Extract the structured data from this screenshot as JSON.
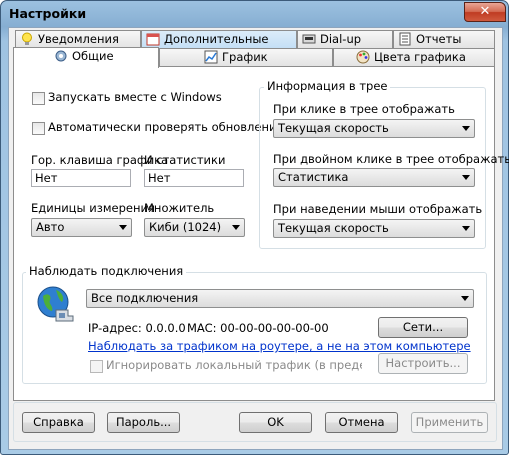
{
  "window": {
    "title": "Настройки",
    "close_label": "✕"
  },
  "tabs": {
    "row1": [
      {
        "label": "Уведомления",
        "icon": "bulb-icon"
      },
      {
        "label": "Дополнительные",
        "icon": "calendar-icon"
      },
      {
        "label": "Dial-up",
        "icon": "dialup-icon"
      },
      {
        "label": "Отчеты",
        "icon": "reports-icon"
      }
    ],
    "row2": [
      {
        "label": "Общие",
        "icon": "general-icon"
      },
      {
        "label": "График",
        "icon": "graph-icon"
      },
      {
        "label": "Цвета графика",
        "icon": "palette-icon"
      }
    ]
  },
  "general": {
    "autostart_label": "Запускать вместе с Windows",
    "autoupdate_label": "Автоматически проверять обновления",
    "hotkey_graph_label": "Гор. клавиша графика",
    "hotkey_stats_label": "И статистики",
    "hotkey_graph_value": "Нет",
    "hotkey_stats_value": "Нет",
    "units_label": "Единицы измерения",
    "units_value": "Авто",
    "multiplier_label": "Множитель",
    "multiplier_value": "Киби (1024)"
  },
  "tray": {
    "group_title": "Информация в трее",
    "click_label": "При клике в трее отображать",
    "click_value": "Текущая скорость",
    "dblclick_label": "При двойном клике в трее отображать",
    "dblclick_value": "Статистика",
    "hover_label": "При наведении мыши отображать",
    "hover_value": "Текущая скорость"
  },
  "connections": {
    "group_title": "Наблюдать подключения",
    "connection_value": "Все подключения",
    "ip_text": "IP-адрес: 0.0.0.0",
    "mac_text": "MAC: 00-00-00-00-00-00",
    "networks_button": "Сети...",
    "router_link": "Наблюдать за трафиком на роутере, а не на этом компьютере",
    "ignore_local_label": "Игнорировать локальный трафик (в пределах сети)",
    "configure_button": "Настроить..."
  },
  "footer": {
    "help": "Справка",
    "password": "Пароль...",
    "ok": "OK",
    "cancel": "Отмена",
    "apply": "Применить"
  }
}
